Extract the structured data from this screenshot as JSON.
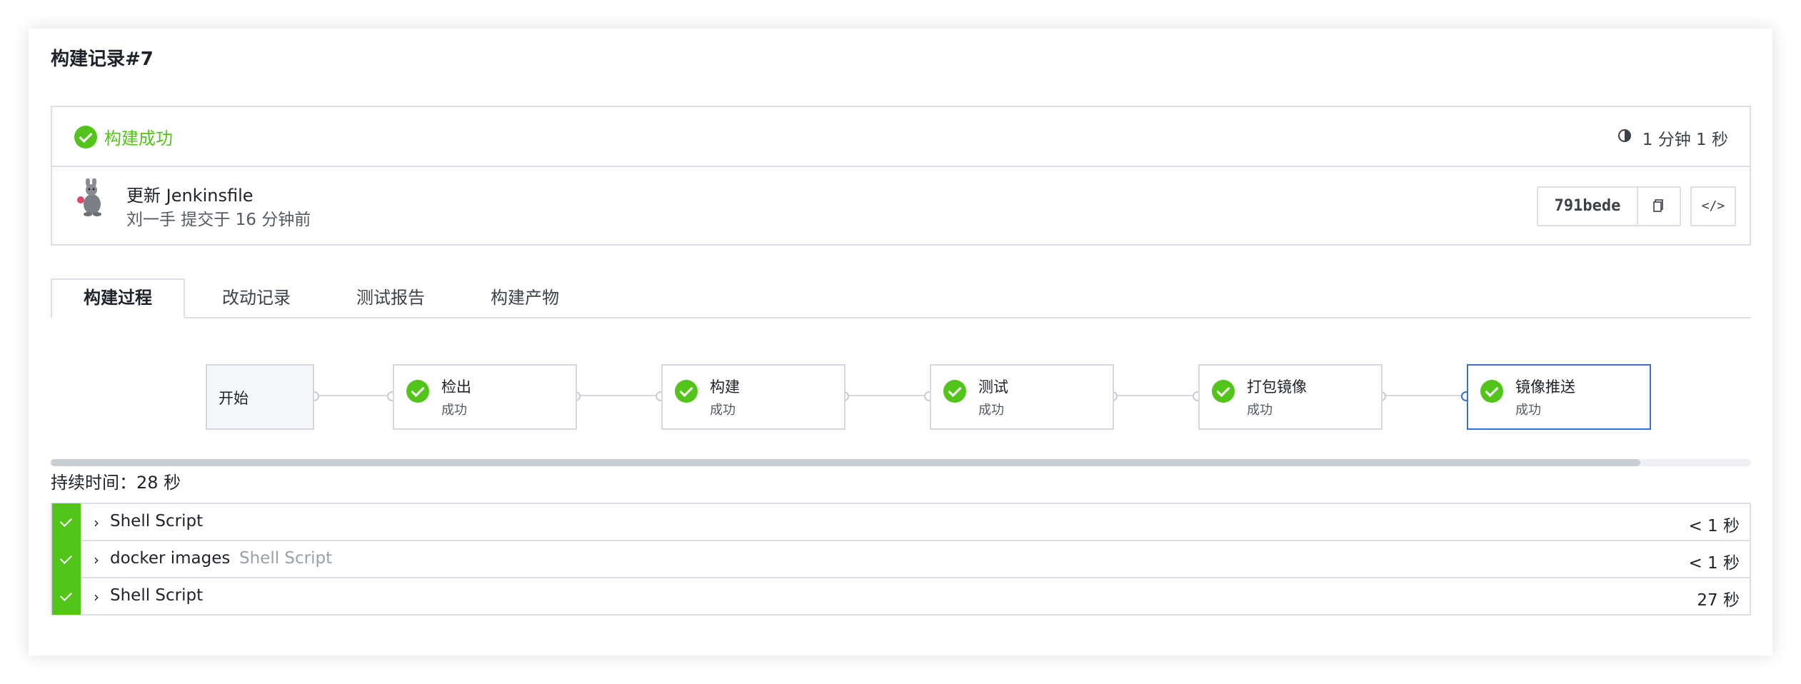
{
  "page": {
    "title": "构建记录#7"
  },
  "status": {
    "label": "构建成功",
    "duration": "1 分钟 1 秒",
    "color": "#52c41a"
  },
  "commit": {
    "message": "更新 Jenkinsfile",
    "meta": "刘一手 提交于 16 分钟前",
    "sha": "791bede",
    "code_label": "</>"
  },
  "tabs": [
    {
      "label": "构建过程",
      "active": true
    },
    {
      "label": "改动记录",
      "active": false
    },
    {
      "label": "测试报告",
      "active": false
    },
    {
      "label": "构建产物",
      "active": false
    }
  ],
  "pipeline": {
    "start_label": "开始",
    "stages": [
      {
        "name": "检出",
        "status": "成功"
      },
      {
        "name": "构建",
        "status": "成功"
      },
      {
        "name": "测试",
        "status": "成功"
      },
      {
        "name": "打包镜像",
        "status": "成功"
      },
      {
        "name": "镜像推送",
        "status": "成功",
        "selected": true
      }
    ],
    "accent": "#3a6fd8"
  },
  "scrollbar": {
    "position": 0,
    "visible_fraction": 0.935
  },
  "duration_line": "持续时间：28 秒",
  "steps": [
    {
      "name": "Shell Script",
      "sub": "",
      "time": "< 1 秒"
    },
    {
      "name": "docker images",
      "sub": "Shell Script",
      "time": "< 1 秒"
    },
    {
      "name": "Shell Script",
      "sub": "",
      "time": "27 秒"
    }
  ],
  "icons": {
    "success": "check-circle-icon",
    "clock": "clock-icon",
    "copy": "copy-icon",
    "code": "code-icon",
    "avatar": "rabbit-avatar",
    "expand": "chevron-right-icon"
  }
}
